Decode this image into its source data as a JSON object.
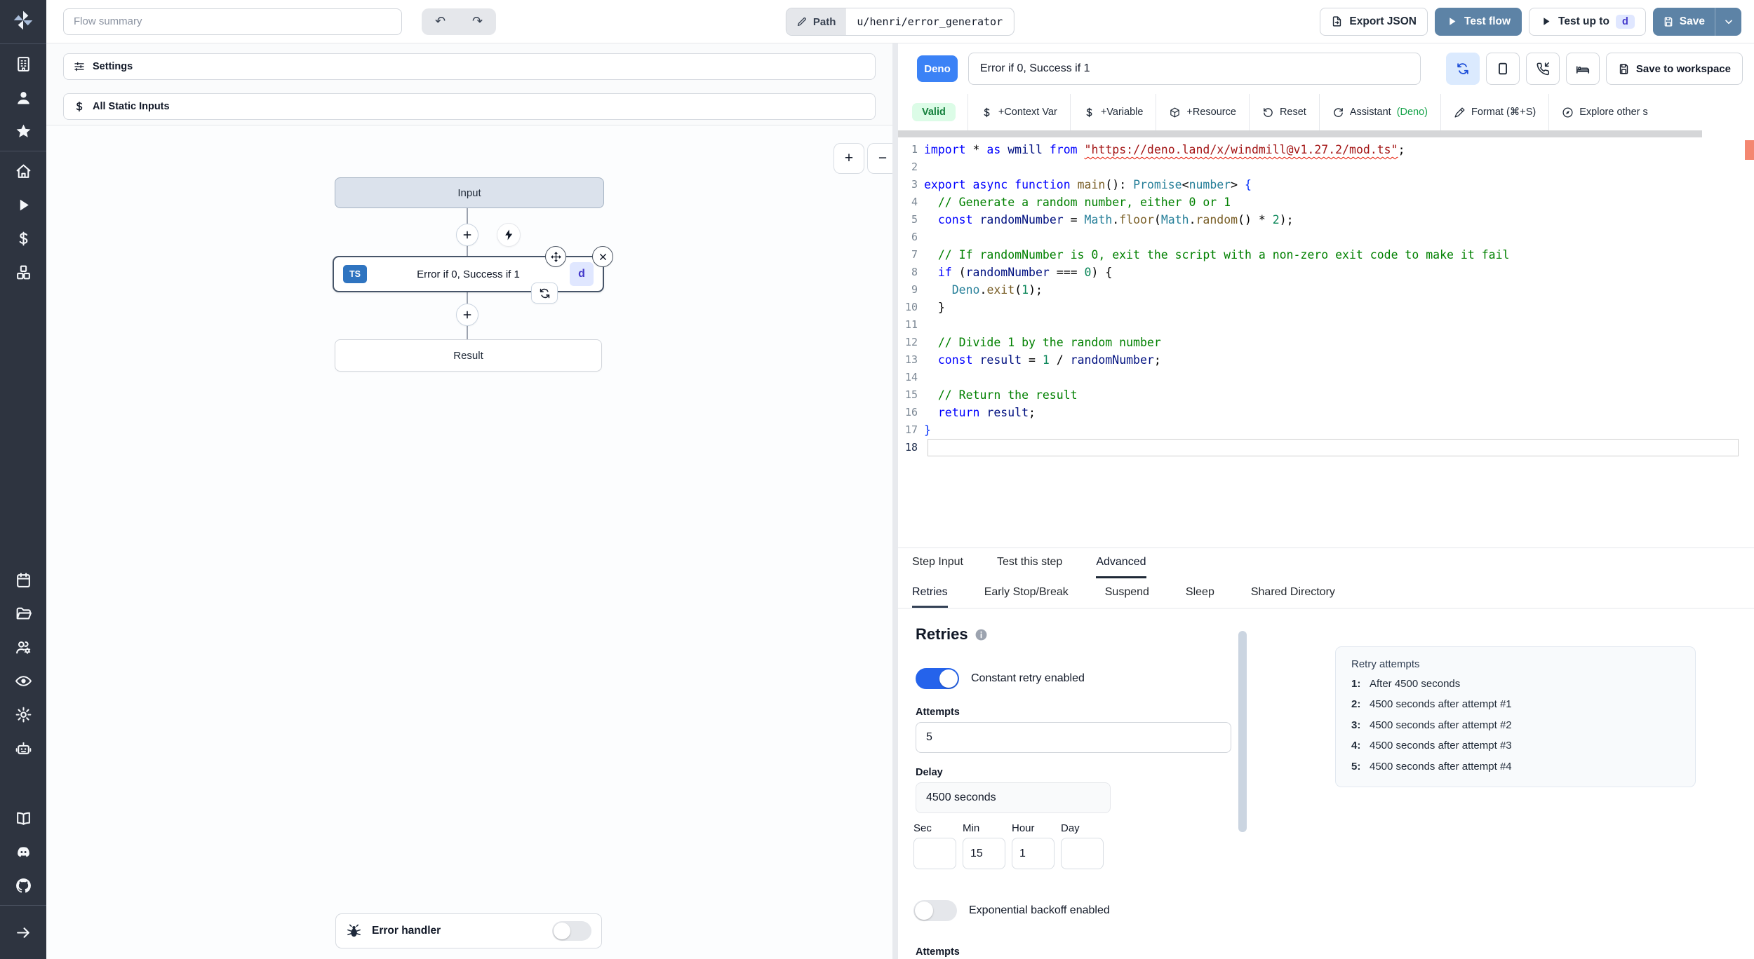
{
  "topbar": {
    "flow_summary_placeholder": "Flow summary",
    "undo_icon": "↶",
    "redo_icon": "↷",
    "path_label": "Path",
    "path_value": "u/henri/error_generator",
    "export_json_label": "Export JSON",
    "test_flow_label": "Test flow",
    "test_up_to_label": "Test up to",
    "test_up_to_badge": "d",
    "save_label": "Save"
  },
  "sidebar": {
    "groups": [
      {
        "items": [
          {
            "icon": "building"
          },
          {
            "icon": "user"
          },
          {
            "icon": "star"
          }
        ]
      },
      {
        "items": [
          {
            "icon": "home"
          },
          {
            "icon": "play"
          },
          {
            "icon": "dollar"
          },
          {
            "icon": "cubes"
          }
        ]
      },
      {
        "items": [
          {
            "icon": "calendar"
          },
          {
            "icon": "folder"
          },
          {
            "icon": "users-gear"
          },
          {
            "icon": "eye"
          },
          {
            "icon": "gear"
          },
          {
            "icon": "robot"
          }
        ]
      },
      {
        "items": [
          {
            "icon": "book"
          },
          {
            "icon": "discord"
          },
          {
            "icon": "github"
          }
        ]
      },
      {
        "items": [
          {
            "icon": "arrow-right"
          }
        ]
      }
    ]
  },
  "flow_panel": {
    "settings_label": "Settings",
    "all_static_inputs_label": "All Static Inputs",
    "zoom_in": "+",
    "zoom_out": "−",
    "input_node_label": "Input",
    "step_node": {
      "lang_badge": "TS",
      "title": "Error if 0, Success if 1",
      "id_badge": "d"
    },
    "result_node_label": "Result",
    "error_handler_label": "Error handler"
  },
  "script_panel": {
    "lang_badge": "Deno",
    "title_value": "Error if 0, Success if 1",
    "header_icons": [
      {
        "icon": "refresh",
        "active": true
      },
      {
        "icon": "square",
        "active": false
      },
      {
        "icon": "phone-incoming",
        "active": false
      },
      {
        "icon": "bed",
        "active": false
      }
    ],
    "save_to_workspace_label": "Save to workspace",
    "toolbar": {
      "valid_label": "Valid",
      "items": [
        {
          "icon": "dollar",
          "label": "+Context Var"
        },
        {
          "icon": "dollar",
          "label": "+Variable"
        },
        {
          "icon": "cube",
          "label": "+Resource"
        },
        {
          "icon": "rotate-ccw",
          "label": "Reset"
        },
        {
          "icon": "rotate-cw",
          "label": "Assistant",
          "suffix": "(Deno)"
        },
        {
          "icon": "format-pen",
          "label": "Format (⌘+S)"
        },
        {
          "icon": "explore",
          "label": "Explore other s"
        }
      ]
    },
    "code_lines": [
      {
        "n": 1,
        "tokens": [
          [
            "k",
            "import"
          ],
          [
            "p",
            " * "
          ],
          [
            "k",
            "as"
          ],
          [
            "p",
            " "
          ],
          [
            "v",
            "wmill"
          ],
          [
            "p",
            " "
          ],
          [
            "k",
            "from"
          ],
          [
            "p",
            " "
          ],
          [
            "u",
            "\"https://deno.land/x/windmill@v1.27.2/mod.ts\""
          ],
          [
            "p",
            ";"
          ]
        ]
      },
      {
        "n": 2,
        "tokens": []
      },
      {
        "n": 3,
        "tokens": [
          [
            "k",
            "export"
          ],
          [
            "p",
            " "
          ],
          [
            "k",
            "async"
          ],
          [
            "p",
            " "
          ],
          [
            "k",
            "function"
          ],
          [
            "p",
            " "
          ],
          [
            "f",
            "main"
          ],
          [
            "p",
            "(): "
          ],
          [
            "t",
            "Promise"
          ],
          [
            "p",
            "<"
          ],
          [
            "t",
            "number"
          ],
          [
            "p",
            "> "
          ],
          [
            "b",
            "{"
          ]
        ]
      },
      {
        "n": 4,
        "tokens": [
          [
            "c",
            "  // Generate a random number, either 0 or 1"
          ]
        ]
      },
      {
        "n": 5,
        "tokens": [
          [
            "p",
            "  "
          ],
          [
            "k",
            "const"
          ],
          [
            "p",
            " "
          ],
          [
            "v",
            "randomNumber"
          ],
          [
            "p",
            " = "
          ],
          [
            "t",
            "Math"
          ],
          [
            "p",
            "."
          ],
          [
            "f",
            "floor"
          ],
          [
            "p",
            "("
          ],
          [
            "t",
            "Math"
          ],
          [
            "p",
            "."
          ],
          [
            "f",
            "random"
          ],
          [
            "p",
            "() * "
          ],
          [
            "n",
            "2"
          ],
          [
            "p",
            ");"
          ]
        ]
      },
      {
        "n": 6,
        "tokens": []
      },
      {
        "n": 7,
        "tokens": [
          [
            "c",
            "  // If randomNumber is 0, exit the script with a non-zero exit code to make it fail"
          ]
        ]
      },
      {
        "n": 8,
        "tokens": [
          [
            "p",
            "  "
          ],
          [
            "k",
            "if"
          ],
          [
            "p",
            " ("
          ],
          [
            "v",
            "randomNumber"
          ],
          [
            "p",
            " === "
          ],
          [
            "n",
            "0"
          ],
          [
            "p",
            ") {"
          ]
        ]
      },
      {
        "n": 9,
        "tokens": [
          [
            "p",
            "    "
          ],
          [
            "t",
            "Deno"
          ],
          [
            "p",
            "."
          ],
          [
            "f",
            "exit"
          ],
          [
            "p",
            "("
          ],
          [
            "n",
            "1"
          ],
          [
            "p",
            ");"
          ]
        ]
      },
      {
        "n": 10,
        "tokens": [
          [
            "p",
            "  }"
          ]
        ]
      },
      {
        "n": 11,
        "tokens": []
      },
      {
        "n": 12,
        "tokens": [
          [
            "c",
            "  // Divide 1 by the random number"
          ]
        ]
      },
      {
        "n": 13,
        "tokens": [
          [
            "p",
            "  "
          ],
          [
            "k",
            "const"
          ],
          [
            "p",
            " "
          ],
          [
            "v",
            "result"
          ],
          [
            "p",
            " = "
          ],
          [
            "n",
            "1"
          ],
          [
            "p",
            " / "
          ],
          [
            "v",
            "randomNumber"
          ],
          [
            "p",
            ";"
          ]
        ]
      },
      {
        "n": 14,
        "tokens": []
      },
      {
        "n": 15,
        "tokens": [
          [
            "c",
            "  // Return the result"
          ]
        ]
      },
      {
        "n": 16,
        "tokens": [
          [
            "p",
            "  "
          ],
          [
            "k",
            "return"
          ],
          [
            "p",
            " "
          ],
          [
            "v",
            "result"
          ],
          [
            "p",
            ";"
          ]
        ]
      },
      {
        "n": 17,
        "tokens": [
          [
            "b",
            "}"
          ]
        ]
      },
      {
        "n": 18,
        "tokens": [],
        "active": true
      }
    ]
  },
  "bottom_panel": {
    "tabs": [
      {
        "label": "Step Input",
        "active": false
      },
      {
        "label": "Test this step",
        "active": false
      },
      {
        "label": "Advanced",
        "active": true
      }
    ],
    "subtabs": [
      {
        "label": "Retries",
        "active": true
      },
      {
        "label": "Early Stop/Break",
        "active": false
      },
      {
        "label": "Suspend",
        "active": false
      },
      {
        "label": "Sleep",
        "active": false
      },
      {
        "label": "Shared Directory",
        "active": false
      }
    ],
    "retries": {
      "heading": "Retries",
      "constant_toggle": {
        "label": "Constant retry enabled",
        "on": true
      },
      "attempts_label": "Attempts",
      "attempts_value": "5",
      "delay_label": "Delay",
      "delay_value": "4500 seconds",
      "time_fields": [
        {
          "label": "Sec",
          "value": ""
        },
        {
          "label": "Min",
          "value": "15"
        },
        {
          "label": "Hour",
          "value": "1"
        },
        {
          "label": "Day",
          "value": ""
        }
      ],
      "exponential_toggle": {
        "label": "Exponential backoff enabled",
        "on": false
      },
      "clipped_label": "Attempts",
      "preview": {
        "title": "Retry attempts",
        "items": [
          {
            "n": "1:",
            "text": "After 4500 seconds"
          },
          {
            "n": "2:",
            "text": "4500 seconds after attempt #1"
          },
          {
            "n": "3:",
            "text": "4500 seconds after attempt #2"
          },
          {
            "n": "4:",
            "text": "4500 seconds after attempt #3"
          },
          {
            "n": "5:",
            "text": "4500 seconds after attempt #4"
          }
        ]
      }
    }
  }
}
